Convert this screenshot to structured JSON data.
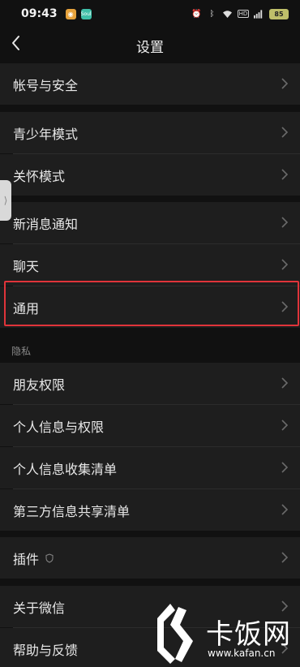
{
  "status_bar": {
    "time": "09:43",
    "apps": [
      "weibo",
      "soul"
    ],
    "soul_label": "Soul",
    "icons": [
      "alarm-icon",
      "bluetooth-icon",
      "wifi-icon",
      "hd-icon",
      "signal-icon"
    ],
    "hd_text": "HD",
    "battery": "85"
  },
  "header": {
    "title": "设置"
  },
  "rows": {
    "account": "帐号与安全",
    "teen": "青少年模式",
    "care": "关怀模式",
    "notifications": "新消息通知",
    "chat": "聊天",
    "general": "通用",
    "friend_perm": "朋友权限",
    "personal_info": "个人信息与权限",
    "info_collect": "个人信息收集清单",
    "third_party": "第三方信息共享清单",
    "plugins": "插件",
    "about": "关于微信",
    "help": "帮助与反馈"
  },
  "sections": {
    "privacy": "隐私"
  },
  "watermark": {
    "brand": "卡饭网",
    "url": "www.kafan.cn"
  },
  "colors": {
    "background": "#111111",
    "row_bg": "#1e1e1e",
    "highlight": "#e0343a"
  }
}
